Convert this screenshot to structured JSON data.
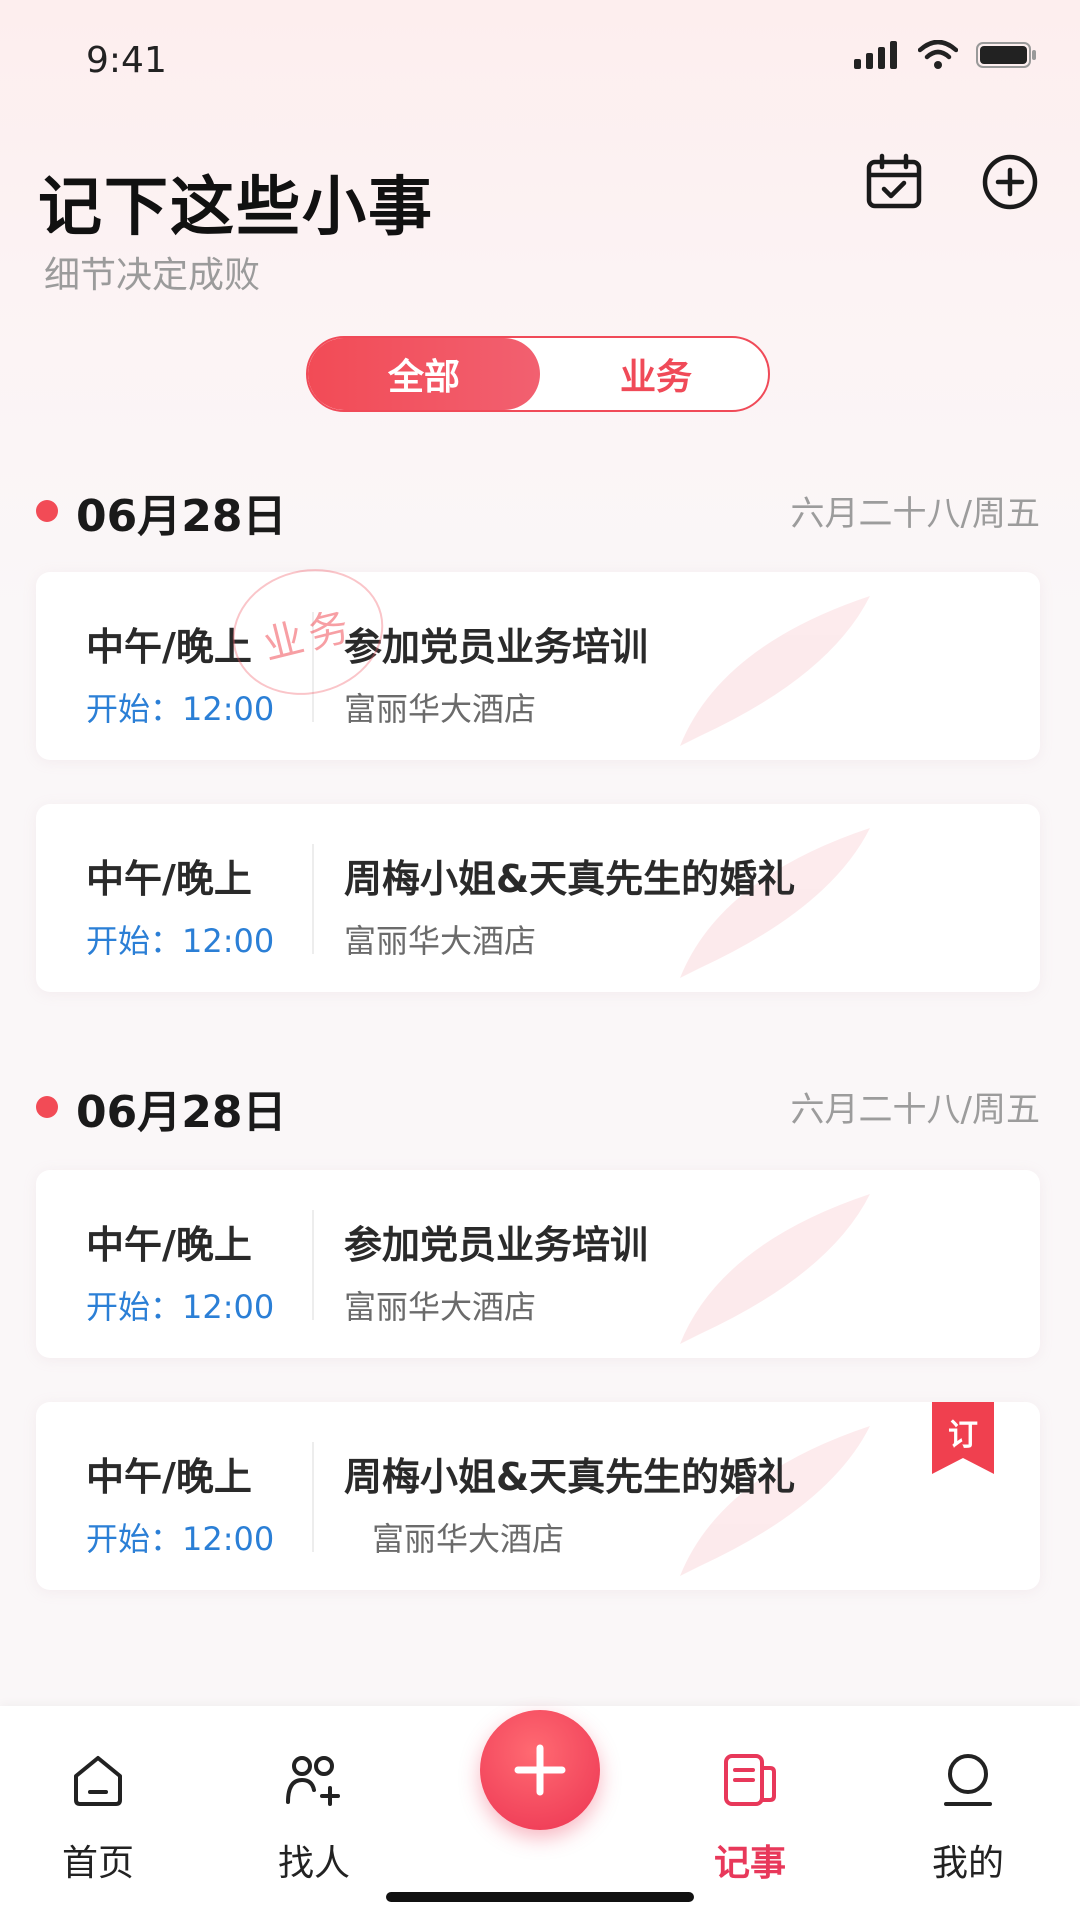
{
  "status_bar": {
    "time": "9:41"
  },
  "header": {
    "title": "记下这些小事",
    "subtitle": "细节决定成败",
    "icons": [
      "calendar-check-icon",
      "plus-circle-icon"
    ]
  },
  "tabs": {
    "all_label": "全部",
    "business_label": "业务",
    "selected": "全部"
  },
  "stamp_text": "业务",
  "groups": [
    {
      "date": "06月28日",
      "lunar": "六月二十八/周五",
      "events": [
        {
          "period": "中午/晚上",
          "start": "开始：12:00",
          "title": "参加党员业务培训",
          "place": "富丽华大酒店"
        },
        {
          "period": "中午/晚上",
          "start": "开始：12:00",
          "title": "周梅小姐&天真先生的婚礼",
          "place": "富丽华大酒店"
        }
      ]
    },
    {
      "date": "06月28日",
      "lunar": "六月二十八/周五",
      "events": [
        {
          "period": "中午/晚上",
          "start": "开始：12:00",
          "title": "参加党员业务培训",
          "place": "富丽华大酒店"
        },
        {
          "period": "中午/晚上",
          "start": "开始：12:00",
          "title": "周梅小姐&天真先生的婚礼",
          "place": "富丽华大酒店",
          "badge": "订"
        }
      ]
    }
  ],
  "tabbar": {
    "items": [
      {
        "label": "首页",
        "icon": "home-icon"
      },
      {
        "label": "找人",
        "icon": "add-person-icon"
      },
      {
        "label": "记事",
        "icon": "notes-icon",
        "active": true
      },
      {
        "label": "我的",
        "icon": "profile-icon"
      }
    ],
    "fab_icon": "plus-icon"
  },
  "colors": {
    "accent": "#f24b56",
    "link_blue": "#2b7fd6",
    "active_tab": "#e8385a"
  }
}
